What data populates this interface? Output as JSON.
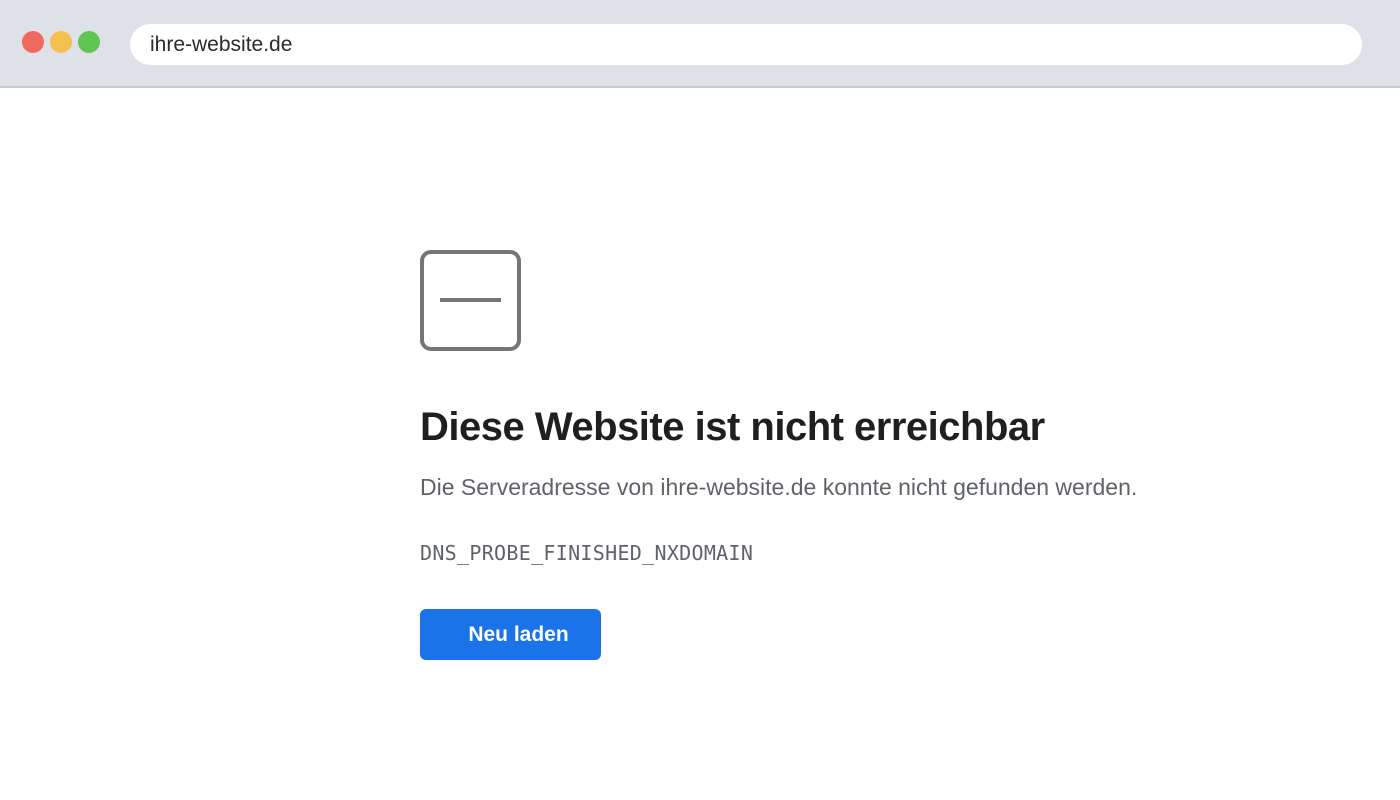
{
  "browser": {
    "url": "ihre-website.de",
    "traffic_lights": {
      "close_color": "#ee6a5e",
      "minimize_color": "#f5bf4f",
      "maximize_color": "#61c554"
    }
  },
  "error_page": {
    "icon": "error-page-icon",
    "title": "Diese Website ist nicht erreichbar",
    "description": "Die Serveradresse von ihre-website.de konnte nicht gefunden werden.",
    "error_code": "DNS_PROBE_FINISHED_NXDOMAIN",
    "reload_label": "Neu laden",
    "accent_color": "#1a73e8"
  }
}
